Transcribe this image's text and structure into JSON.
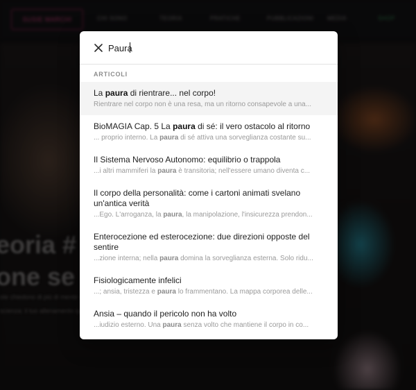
{
  "background": {
    "logo_label": "SUSIE MARCHI",
    "nav_items": [
      "CHI SONO",
      "TEORIA",
      "PRATICHE",
      "PUBBLICAZIONI",
      "MEDIA",
      "SHOP"
    ],
    "headline_1": "eoria #",
    "headline_2": "one se",
    "subline_1": "ole chiedono di più di mente coer",
    "subline_2": "scienza: il tuo allenamento quoti",
    "overlay_color": "#000000"
  },
  "search": {
    "value": "Paura",
    "close_label": "close"
  },
  "section_label": "ARTICOLI",
  "results": [
    {
      "title_before": "La ",
      "title_hit": "paura",
      "title_after": " di rientrare... nel corpo!",
      "snippet_before": "Rientrare nel corpo non è una resa, ma un ritorno consapevole a una...",
      "snippet_hit": "",
      "snippet_after": ""
    },
    {
      "title_before": "BioMAGIA Cap. 5 La ",
      "title_hit": "paura",
      "title_after": " di sé: il vero ostacolo al ritorno",
      "snippet_before": "... proprio interno. La ",
      "snippet_hit": "paura",
      "snippet_after": " di sé attiva una sorveglianza costante su..."
    },
    {
      "title_before": "Il Sistema Nervoso Autonomo: equilibrio o trappola",
      "title_hit": "",
      "title_after": "",
      "snippet_before": "...i altri mammiferi la ",
      "snippet_hit": "paura",
      "snippet_after": " è transitoria; nell'essere umano diventa c..."
    },
    {
      "title_before": "Il corpo della personalità: come i cartoni animati svelano un'antica verità",
      "title_hit": "",
      "title_after": "",
      "snippet_before": "...Ego. L'arroganza, la ",
      "snippet_hit": "paura",
      "snippet_after": ", la manipolazione, l'insicurezza prendon..."
    },
    {
      "title_before": "Enterocezione ed esterocezione: due direzioni opposte del sentire",
      "title_hit": "",
      "title_after": "",
      "snippet_before": "...zione interna; nella ",
      "snippet_hit": "paura",
      "snippet_after": " domina la sorveglianza esterna. Solo ridu..."
    },
    {
      "title_before": "Fisiologicamente infelici",
      "title_hit": "",
      "title_after": "",
      "snippet_before": "...; ansia, tristezza e ",
      "snippet_hit": "paura",
      "snippet_after": " lo frammentano. La mappa corporea delle..."
    },
    {
      "title_before": "Ansia – quando il pericolo non ha volto",
      "title_hit": "",
      "title_after": "",
      "snippet_before": "...iudizio esterno. Una ",
      "snippet_hit": "paura",
      "snippet_after": " senza volto che mantiene il corpo in co..."
    }
  ]
}
